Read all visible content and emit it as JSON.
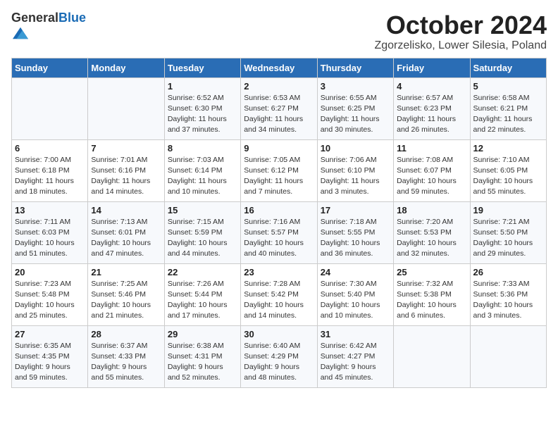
{
  "header": {
    "logo_general": "General",
    "logo_blue": "Blue",
    "title": "October 2024",
    "subtitle": "Zgorzelisko, Lower Silesia, Poland"
  },
  "days_of_week": [
    "Sunday",
    "Monday",
    "Tuesday",
    "Wednesday",
    "Thursday",
    "Friday",
    "Saturday"
  ],
  "weeks": [
    [
      {
        "day": "",
        "detail": ""
      },
      {
        "day": "",
        "detail": ""
      },
      {
        "day": "1",
        "detail": "Sunrise: 6:52 AM\nSunset: 6:30 PM\nDaylight: 11 hours\nand 37 minutes."
      },
      {
        "day": "2",
        "detail": "Sunrise: 6:53 AM\nSunset: 6:27 PM\nDaylight: 11 hours\nand 34 minutes."
      },
      {
        "day": "3",
        "detail": "Sunrise: 6:55 AM\nSunset: 6:25 PM\nDaylight: 11 hours\nand 30 minutes."
      },
      {
        "day": "4",
        "detail": "Sunrise: 6:57 AM\nSunset: 6:23 PM\nDaylight: 11 hours\nand 26 minutes."
      },
      {
        "day": "5",
        "detail": "Sunrise: 6:58 AM\nSunset: 6:21 PM\nDaylight: 11 hours\nand 22 minutes."
      }
    ],
    [
      {
        "day": "6",
        "detail": "Sunrise: 7:00 AM\nSunset: 6:18 PM\nDaylight: 11 hours\nand 18 minutes."
      },
      {
        "day": "7",
        "detail": "Sunrise: 7:01 AM\nSunset: 6:16 PM\nDaylight: 11 hours\nand 14 minutes."
      },
      {
        "day": "8",
        "detail": "Sunrise: 7:03 AM\nSunset: 6:14 PM\nDaylight: 11 hours\nand 10 minutes."
      },
      {
        "day": "9",
        "detail": "Sunrise: 7:05 AM\nSunset: 6:12 PM\nDaylight: 11 hours\nand 7 minutes."
      },
      {
        "day": "10",
        "detail": "Sunrise: 7:06 AM\nSunset: 6:10 PM\nDaylight: 11 hours\nand 3 minutes."
      },
      {
        "day": "11",
        "detail": "Sunrise: 7:08 AM\nSunset: 6:07 PM\nDaylight: 10 hours\nand 59 minutes."
      },
      {
        "day": "12",
        "detail": "Sunrise: 7:10 AM\nSunset: 6:05 PM\nDaylight: 10 hours\nand 55 minutes."
      }
    ],
    [
      {
        "day": "13",
        "detail": "Sunrise: 7:11 AM\nSunset: 6:03 PM\nDaylight: 10 hours\nand 51 minutes."
      },
      {
        "day": "14",
        "detail": "Sunrise: 7:13 AM\nSunset: 6:01 PM\nDaylight: 10 hours\nand 47 minutes."
      },
      {
        "day": "15",
        "detail": "Sunrise: 7:15 AM\nSunset: 5:59 PM\nDaylight: 10 hours\nand 44 minutes."
      },
      {
        "day": "16",
        "detail": "Sunrise: 7:16 AM\nSunset: 5:57 PM\nDaylight: 10 hours\nand 40 minutes."
      },
      {
        "day": "17",
        "detail": "Sunrise: 7:18 AM\nSunset: 5:55 PM\nDaylight: 10 hours\nand 36 minutes."
      },
      {
        "day": "18",
        "detail": "Sunrise: 7:20 AM\nSunset: 5:53 PM\nDaylight: 10 hours\nand 32 minutes."
      },
      {
        "day": "19",
        "detail": "Sunrise: 7:21 AM\nSunset: 5:50 PM\nDaylight: 10 hours\nand 29 minutes."
      }
    ],
    [
      {
        "day": "20",
        "detail": "Sunrise: 7:23 AM\nSunset: 5:48 PM\nDaylight: 10 hours\nand 25 minutes."
      },
      {
        "day": "21",
        "detail": "Sunrise: 7:25 AM\nSunset: 5:46 PM\nDaylight: 10 hours\nand 21 minutes."
      },
      {
        "day": "22",
        "detail": "Sunrise: 7:26 AM\nSunset: 5:44 PM\nDaylight: 10 hours\nand 17 minutes."
      },
      {
        "day": "23",
        "detail": "Sunrise: 7:28 AM\nSunset: 5:42 PM\nDaylight: 10 hours\nand 14 minutes."
      },
      {
        "day": "24",
        "detail": "Sunrise: 7:30 AM\nSunset: 5:40 PM\nDaylight: 10 hours\nand 10 minutes."
      },
      {
        "day": "25",
        "detail": "Sunrise: 7:32 AM\nSunset: 5:38 PM\nDaylight: 10 hours\nand 6 minutes."
      },
      {
        "day": "26",
        "detail": "Sunrise: 7:33 AM\nSunset: 5:36 PM\nDaylight: 10 hours\nand 3 minutes."
      }
    ],
    [
      {
        "day": "27",
        "detail": "Sunrise: 6:35 AM\nSunset: 4:35 PM\nDaylight: 9 hours\nand 59 minutes."
      },
      {
        "day": "28",
        "detail": "Sunrise: 6:37 AM\nSunset: 4:33 PM\nDaylight: 9 hours\nand 55 minutes."
      },
      {
        "day": "29",
        "detail": "Sunrise: 6:38 AM\nSunset: 4:31 PM\nDaylight: 9 hours\nand 52 minutes."
      },
      {
        "day": "30",
        "detail": "Sunrise: 6:40 AM\nSunset: 4:29 PM\nDaylight: 9 hours\nand 48 minutes."
      },
      {
        "day": "31",
        "detail": "Sunrise: 6:42 AM\nSunset: 4:27 PM\nDaylight: 9 hours\nand 45 minutes."
      },
      {
        "day": "",
        "detail": ""
      },
      {
        "day": "",
        "detail": ""
      }
    ]
  ]
}
